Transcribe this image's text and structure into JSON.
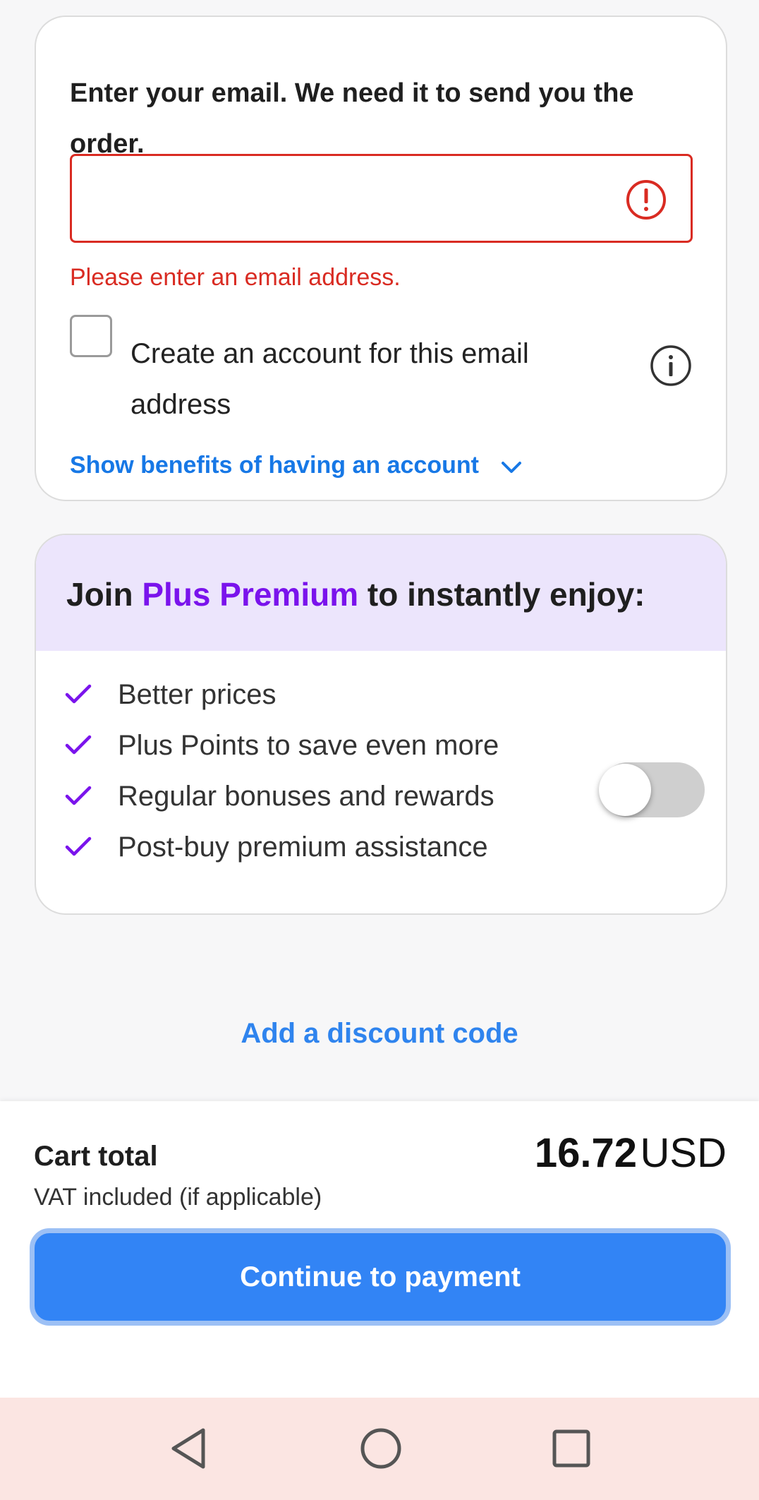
{
  "email_section": {
    "heading": "Enter your email. We need it to send you the order.",
    "input_value": "",
    "input_placeholder": "",
    "error_message": "Please enter an email address.",
    "create_account_label": "Create an account for this email address",
    "create_account_checked": false,
    "benefits_link": "Show benefits of having an account"
  },
  "premium": {
    "title_prefix": "Join ",
    "title_brand": "Plus Premium",
    "title_suffix": " to instantly enjoy:",
    "benefits": [
      "Better prices",
      "Plus Points to save even more",
      "Regular bonuses and rewards",
      "Post-buy premium assistance"
    ],
    "toggle_on": false
  },
  "discount_link": "Add a discount code",
  "cart": {
    "label": "Cart total",
    "subtext": "VAT included (if applicable)",
    "amount": "16.72",
    "currency": "USD"
  },
  "payment_button": "Continue to payment",
  "colors": {
    "error": "#d92b22",
    "link": "#1778e6",
    "brand_purple": "#7a13ec",
    "primary_button": "#3284f5"
  },
  "icons": {
    "error": "error-icon",
    "info": "info-icon",
    "chevron": "chevron-down-icon",
    "check": "check-icon",
    "nav_back": "back-icon",
    "nav_home": "home-icon",
    "nav_recent": "recent-apps-icon"
  }
}
